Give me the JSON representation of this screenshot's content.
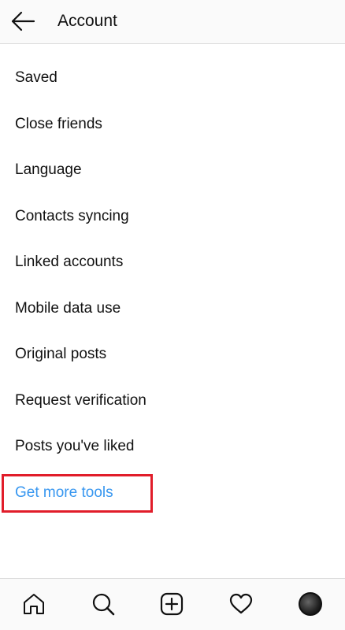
{
  "header": {
    "title": "Account",
    "back_icon": "arrow-left-icon"
  },
  "menu": {
    "items": [
      {
        "label": "Saved"
      },
      {
        "label": "Close friends"
      },
      {
        "label": "Language"
      },
      {
        "label": "Contacts syncing"
      },
      {
        "label": "Linked accounts"
      },
      {
        "label": "Mobile data use"
      },
      {
        "label": "Original posts"
      },
      {
        "label": "Request verification"
      },
      {
        "label": "Posts you've liked"
      },
      {
        "label": "Get more tools"
      }
    ]
  },
  "colors": {
    "link": "#3897f0",
    "highlight_box": "#e11d2a",
    "divider": "#dbdbdb"
  },
  "tabbar": {
    "icons": [
      "home-icon",
      "search-icon",
      "new-post-icon",
      "activity-heart-icon",
      "profile-avatar"
    ]
  }
}
